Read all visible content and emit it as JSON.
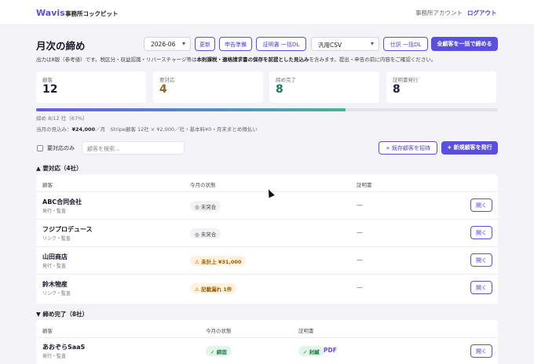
{
  "header": {
    "brand": "Wavis",
    "brand_sub": "事務所コックピット",
    "account": "事務所アカウント",
    "logout": "ログアウト"
  },
  "toolbar": {
    "title": "月次の締め",
    "month": "2026-06",
    "refresh": "更新",
    "filing_prep": "申告準備",
    "certs_dl": "証明書 一括DL",
    "csv_format": "汎用CSV",
    "journal_dl": "仕訳 一括DL",
    "close_all": "全顧客を一括で締める"
  },
  "notice": {
    "prefix": "出力は8版（参考値）です。税区分・収益認識・リバースチャージ等は",
    "bold": "本則課税・適格請求書の保存を前提とした見込み",
    "suffix": "を含みます。提出・申告の前に内容をご確認ください。"
  },
  "stats": [
    {
      "label": "顧客",
      "value": "12",
      "color": "#16182a"
    },
    {
      "label": "要対応",
      "value": "4",
      "color": "#8a6a1e"
    },
    {
      "label": "締め完了",
      "value": "8",
      "color": "#1e7a5a"
    },
    {
      "label": "証明書発行",
      "value": "8",
      "color": "#16182a"
    }
  ],
  "progress": {
    "fraction": 0.67,
    "text": "締め 8/12 社（67%）"
  },
  "estimate": {
    "prefix": "当月の見込み：",
    "amount": "¥24,000",
    "suffix": "／月　Stripe顧客 12社 × ¥2,000／社・基本料¥0・月末まとめ徴払い"
  },
  "filters": {
    "only_action": "要対応のみ",
    "search_placeholder": "顧客を検索...",
    "invite": "+ 既存顧客を招待",
    "issue": "+ 新規顧客を発行"
  },
  "section_action": {
    "title": "▲ 要対応（4社）",
    "headers": {
      "client": "顧客",
      "status": "今月の状態",
      "cert": "証明書"
    },
    "rows": [
      {
        "name": "ABC合同会社",
        "sub": "発行・監査",
        "status": "◎ 未突合",
        "tone": "gray",
        "cert": "—",
        "action": "開く"
      },
      {
        "name": "フジプロデュース",
        "sub": "リンク・監査",
        "status": "◎ 未突合",
        "tone": "gray",
        "cert": "—",
        "action": "開く"
      },
      {
        "name": "山田商店",
        "sub": "発行・監査",
        "status": "⚠ 未計上 ¥31,000",
        "tone": "orange",
        "cert": "—",
        "action": "開く"
      },
      {
        "name": "鈴木物産",
        "sub": "リンク・監査",
        "status": "⚠ 記載漏れ 1件",
        "tone": "orange",
        "cert": "—",
        "action": "開く"
      }
    ]
  },
  "section_done": {
    "title": "▼ 締め完了（8社）",
    "headers": {
      "client": "顧客",
      "status": "今月の状態",
      "cert": "証明書"
    },
    "rows": [
      {
        "name": "あおぞらSaaS",
        "sub": "発行・監査",
        "status": "✓ 締固",
        "cert_status": "✓ 封緘",
        "pdf": "PDF",
        "action": "開く"
      }
    ]
  },
  "colors": {
    "accent": "#5b4fe0",
    "bg": "#f4f4f8"
  }
}
